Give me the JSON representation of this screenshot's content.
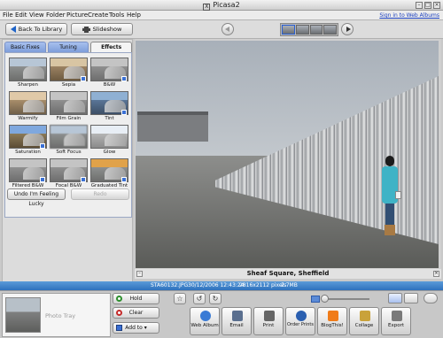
{
  "window": {
    "title": "Picasa2",
    "app_icon": "X"
  },
  "menu": {
    "items": [
      "File",
      "Edit",
      "View",
      "Folder",
      "Picture",
      "Create",
      "Tools",
      "Help"
    ],
    "signin_link": "Sign in to Web Albums"
  },
  "toolbar": {
    "back_label": "Back To Library",
    "slideshow_label": "Slideshow"
  },
  "tabs": [
    {
      "label": "Basic Fixes",
      "active": false
    },
    {
      "label": "Tuning",
      "active": false
    },
    {
      "label": "Effects",
      "active": true
    }
  ],
  "effects": [
    {
      "label": "Sharpen",
      "icon": "sharpen-effect-thumb"
    },
    {
      "label": "Sepia",
      "icon": "sepia-effect-thumb"
    },
    {
      "label": "B&W",
      "icon": "bw-effect-thumb"
    },
    {
      "label": "Warmify",
      "icon": "warmify-effect-thumb"
    },
    {
      "label": "Film Grain",
      "icon": "film-grain-effect-thumb"
    },
    {
      "label": "Tint",
      "icon": "tint-effect-thumb"
    },
    {
      "label": "Saturation",
      "icon": "saturation-effect-thumb"
    },
    {
      "label": "Soft Focus",
      "icon": "soft-focus-effect-thumb"
    },
    {
      "label": "Glow",
      "icon": "glow-effect-thumb"
    },
    {
      "label": "Filtered B&W",
      "icon": "filtered-bw-effect-thumb"
    },
    {
      "label": "Focal B&W",
      "icon": "focal-bw-effect-thumb"
    },
    {
      "label": "Graduated Tint",
      "icon": "graduated-tint-effect-thumb"
    }
  ],
  "panel_buttons": {
    "lucky_label": "Undo I'm Feeling Lucky",
    "redo_label": "Redo"
  },
  "photo": {
    "caption": "Sheaf Square, Sheffield"
  },
  "info": {
    "filename": "STA60132.JPG",
    "datetime": "30/12/2006 12:43:24",
    "dimensions": "2816x2112 pixels",
    "filesize": "2.7MB"
  },
  "tray": {
    "label": "Photo Tray",
    "hold_label": "Hold",
    "clear_label": "Clear",
    "addto_label": "Add to"
  },
  "actions": [
    {
      "label": "Web Album",
      "icon": "web-album-icon",
      "color": "#3a7bd5"
    },
    {
      "label": "Email",
      "icon": "email-icon",
      "color": "#5a6f8f"
    },
    {
      "label": "Print",
      "icon": "print-icon",
      "color": "#666666"
    },
    {
      "label": "Order Prints",
      "icon": "order-prints-icon",
      "color": "#2a5fb0"
    },
    {
      "label": "BlogThis!",
      "icon": "blogthis-icon",
      "color": "#f07c1a"
    },
    {
      "label": "Collage",
      "icon": "collage-icon",
      "color": "#c9a23a"
    },
    {
      "label": "Export",
      "icon": "export-icon",
      "color": "#7a7a7a"
    }
  ],
  "colors": {
    "accent": "#2e71bd",
    "tab_inactive": "#8eaee6"
  }
}
